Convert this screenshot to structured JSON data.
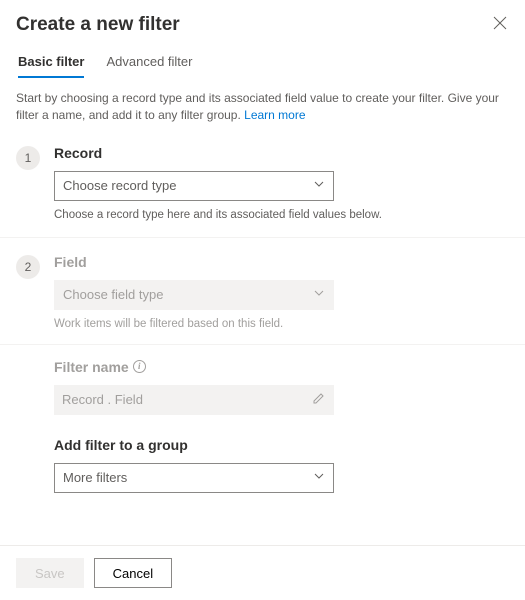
{
  "header": {
    "title": "Create a new filter"
  },
  "tabs": {
    "basic": "Basic filter",
    "advanced": "Advanced filter"
  },
  "intro": {
    "text": "Start by choosing a record type and its associated field value to create your filter. Give your filter a name, and add it to any filter group. ",
    "link": "Learn more"
  },
  "step1": {
    "num": "1",
    "label": "Record",
    "placeholder": "Choose record type",
    "helper": "Choose a record type here and its associated field values below."
  },
  "step2": {
    "num": "2",
    "label": "Field",
    "placeholder": "Choose field type",
    "helper": "Work items will be filtered based on this field."
  },
  "filterName": {
    "label": "Filter name",
    "placeholder": "Record . Field"
  },
  "group": {
    "label": "Add filter to a group",
    "value": "More filters"
  },
  "footer": {
    "save": "Save",
    "cancel": "Cancel"
  }
}
